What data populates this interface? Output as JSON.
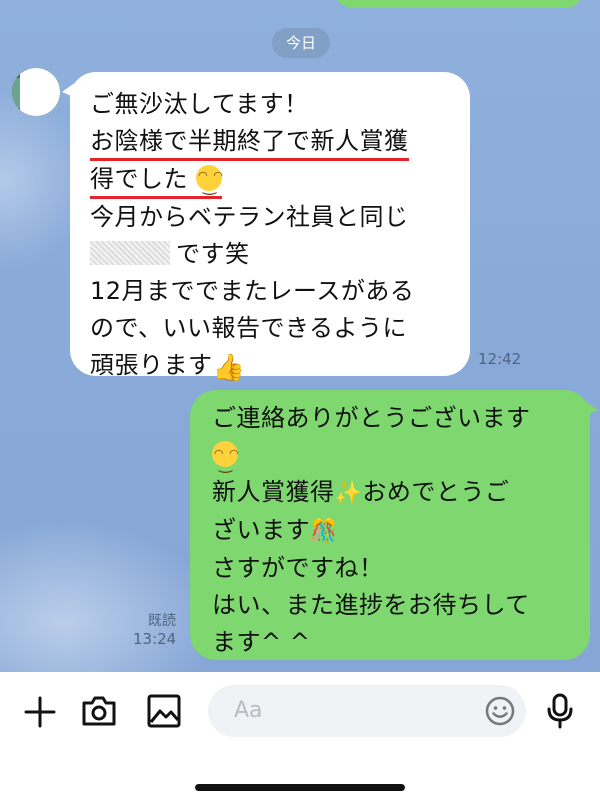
{
  "chat": {
    "date_label": "今日",
    "incoming": {
      "lines": [
        "ご無沙汰してます！",
        "お陰様で半期終了で新人賞獲",
        "得でした",
        "今月からベテラン社員と同じ",
        "です笑",
        "12月まででまたレースがある",
        "ので、いい報告できるように",
        "頑張ります"
      ],
      "time": "12:42"
    },
    "outgoing": {
      "lines": [
        "ご連絡ありがとうございます",
        "新人賞獲得",
        "おめでとうご",
        "ざいます",
        "さすがですね！",
        "はい、また進捗をお待ちして",
        "ます^ ^"
      ],
      "read_label": "既読",
      "time": "13:24"
    },
    "colors": {
      "background": "#8aaad8",
      "outgoing_bubble": "#7ed86f",
      "incoming_bubble": "#ffffff",
      "underline": "#e5232d"
    }
  },
  "input_bar": {
    "placeholder": "Aa",
    "icons": [
      "plus-icon",
      "camera-icon",
      "image-icon",
      "emoji-icon",
      "mic-icon"
    ]
  }
}
